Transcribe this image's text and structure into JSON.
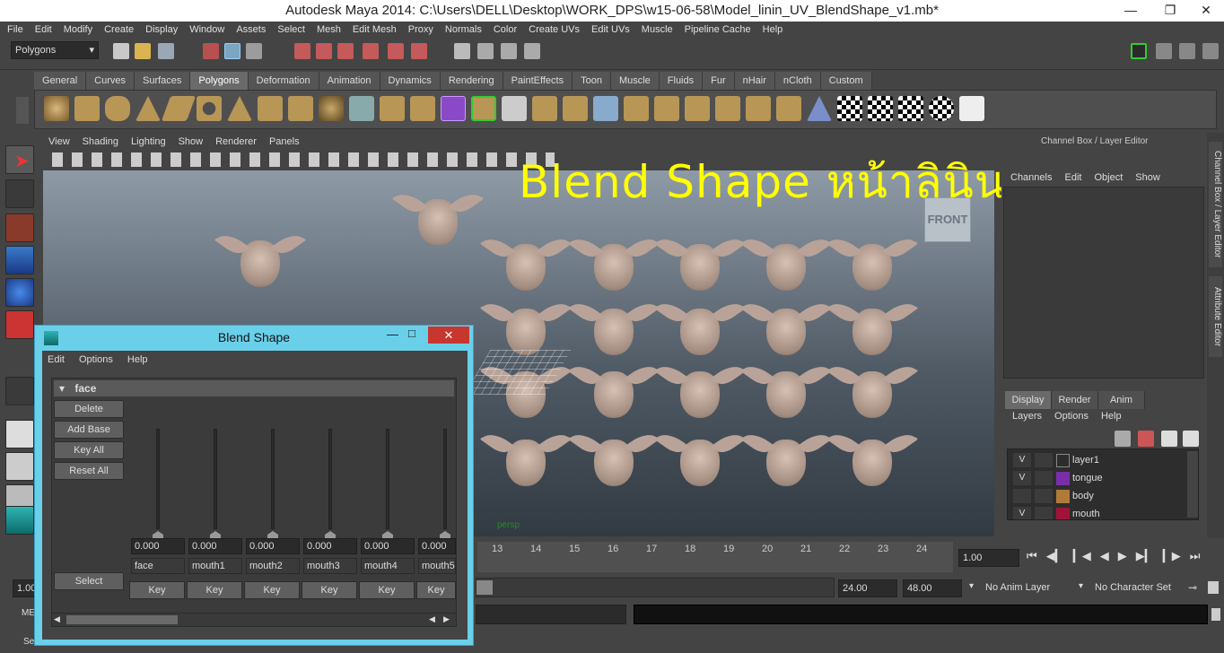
{
  "window": {
    "title": "Autodesk Maya 2014: C:\\Users\\DELL\\Desktop\\WORK_DPS\\w15-06-58\\Model_linin_UV_BlendShape_v1.mb*"
  },
  "menubar": [
    "File",
    "Edit",
    "Modify",
    "Create",
    "Display",
    "Window",
    "Assets",
    "Select",
    "Mesh",
    "Edit Mesh",
    "Proxy",
    "Normals",
    "Color",
    "Create UVs",
    "Edit UVs",
    "Muscle",
    "Pipeline Cache",
    "Help"
  ],
  "status": {
    "mode": "Polygons"
  },
  "shelf_tabs": [
    "General",
    "Curves",
    "Surfaces",
    "Polygons",
    "Deformation",
    "Animation",
    "Dynamics",
    "Rendering",
    "PaintEffects",
    "Toon",
    "Muscle",
    "Fluids",
    "Fur",
    "nHair",
    "nCloth",
    "Custom"
  ],
  "panel_menu": [
    "View",
    "Shading",
    "Lighting",
    "Show",
    "Renderer",
    "Panels"
  ],
  "viewport": {
    "cube_label": "FRONT",
    "camera": "persp"
  },
  "overlay_text": "Blend Shape หน้าลินิน",
  "channel_box": {
    "title": "Channel Box / Layer Editor",
    "menu": [
      "Channels",
      "Edit",
      "Object",
      "Show"
    ]
  },
  "side_tabs": [
    "Channel Box / Layer Editor",
    "Attribute Editor"
  ],
  "layer_editor": {
    "tabs": [
      "Display",
      "Render",
      "Anim"
    ],
    "menu": [
      "Layers",
      "Options",
      "Help"
    ],
    "layers": [
      {
        "v": "V",
        "name": "layer1",
        "color": "#3a3a3a"
      },
      {
        "v": "V",
        "name": "tongue",
        "color": "#7a2fa8"
      },
      {
        "v": "",
        "name": "body",
        "color": "#b07a3a"
      },
      {
        "v": "V",
        "name": "mouth",
        "color": "#a0143a"
      }
    ]
  },
  "timeline": {
    "ticks": [
      "13",
      "14",
      "15",
      "16",
      "17",
      "18",
      "19",
      "20",
      "21",
      "22",
      "23",
      "24"
    ],
    "current": "1.00"
  },
  "range": {
    "start_left": "1.00",
    "end": "24.00",
    "max": "48.00",
    "anim_layer": "No Anim Layer",
    "char_set": "No Character Set"
  },
  "helpline": {
    "left_a": "MEL",
    "left_b": "Se"
  },
  "blend_shape": {
    "title": "Blend Shape",
    "menu": [
      "Edit",
      "Options",
      "Help"
    ],
    "node": "face",
    "buttons": {
      "delete": "Delete",
      "add_base": "Add Base",
      "key_all": "Key All",
      "reset_all": "Reset All",
      "select": "Select"
    },
    "targets": [
      {
        "name": "face",
        "value": "0.000",
        "key": "Key"
      },
      {
        "name": "mouth1",
        "value": "0.000",
        "key": "Key"
      },
      {
        "name": "mouth2",
        "value": "0.000",
        "key": "Key"
      },
      {
        "name": "mouth3",
        "value": "0.000",
        "key": "Key"
      },
      {
        "name": "mouth4",
        "value": "0.000",
        "key": "Key"
      },
      {
        "name": "mouth5",
        "value": "0.000",
        "key": "Key"
      }
    ]
  }
}
